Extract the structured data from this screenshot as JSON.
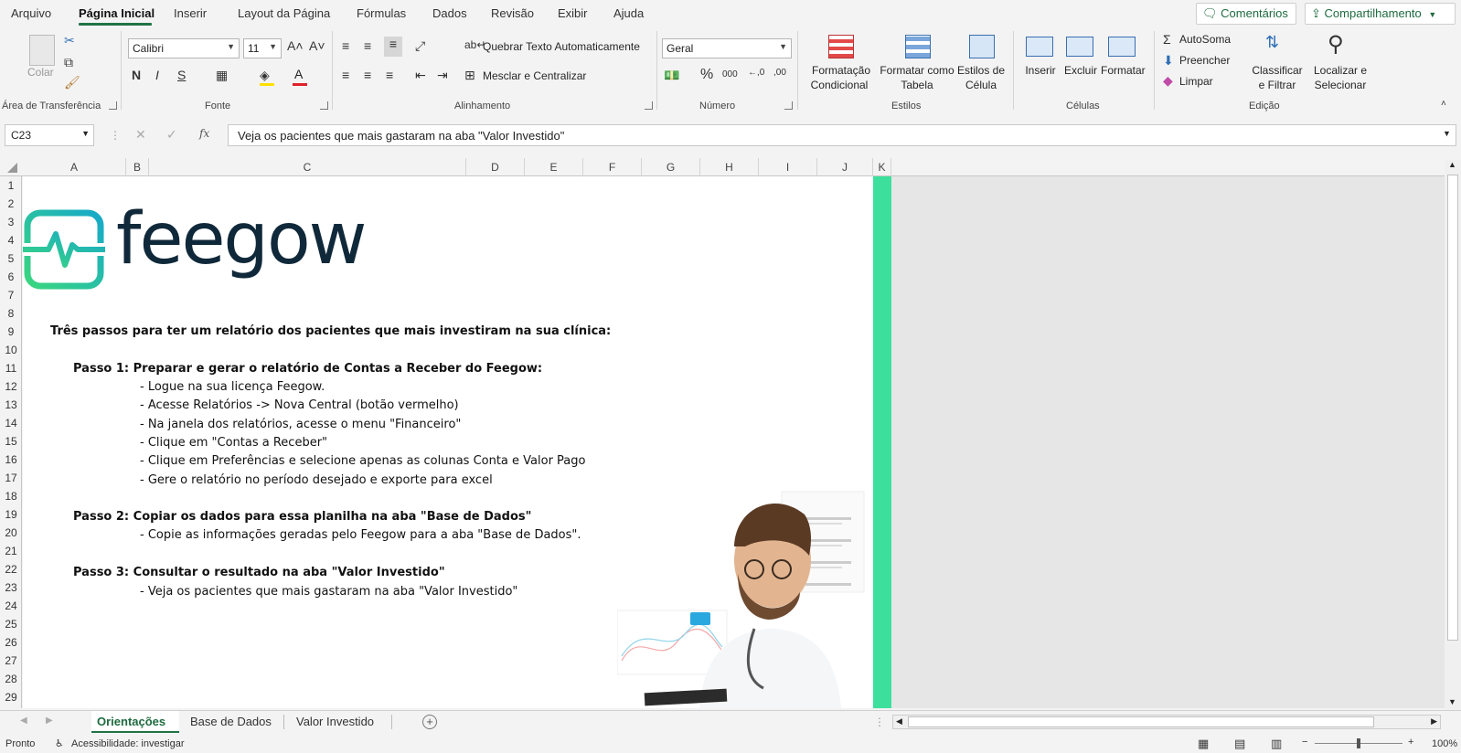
{
  "menu": {
    "tabs": [
      "Arquivo",
      "Página Inicial",
      "Inserir",
      "Layout da Página",
      "Fórmulas",
      "Dados",
      "Revisão",
      "Exibir",
      "Ajuda"
    ],
    "comments_label": "Comentários",
    "share_label": "Compartilhamento"
  },
  "ribbon": {
    "clipboard": {
      "paste": "Colar",
      "group": "Área de Transferência"
    },
    "font": {
      "name": "Calibri",
      "size": "11",
      "bold": "N",
      "italic": "I",
      "underline": "S",
      "group": "Fonte"
    },
    "alignment": {
      "wrap": "Quebrar Texto Automaticamente",
      "merge": "Mesclar e Centralizar",
      "group": "Alinhamento"
    },
    "number": {
      "format": "Geral",
      "group": "Número"
    },
    "styles": {
      "conditional": [
        "Formatação",
        "Condicional"
      ],
      "table": [
        "Formatar como",
        "Tabela"
      ],
      "cell": [
        "Estilos de",
        "Célula"
      ],
      "group": "Estilos"
    },
    "cells": {
      "insert": "Inserir",
      "delete": "Excluir",
      "format": "Formatar",
      "group": "Células"
    },
    "editing": {
      "autosum": "AutoSoma",
      "fill": "Preencher",
      "clear": "Limpar",
      "sort": [
        "Classificar",
        "e Filtrar"
      ],
      "find": [
        "Localizar e",
        "Selecionar"
      ],
      "group": "Edição"
    }
  },
  "formula_bar": {
    "name_box": "C23",
    "content": "Veja os pacientes que mais gastaram na aba \"Valor Investido\""
  },
  "columns": [
    "A",
    "B",
    "C",
    "D",
    "E",
    "F",
    "G",
    "H",
    "I",
    "J",
    "K"
  ],
  "rows": [
    "1",
    "2",
    "3",
    "4",
    "5",
    "6",
    "7",
    "8",
    "9",
    "10",
    "11",
    "12",
    "13",
    "14",
    "15",
    "16",
    "17",
    "18",
    "19",
    "20",
    "21",
    "22",
    "23",
    "24",
    "25",
    "26",
    "27",
    "28",
    "29"
  ],
  "sheet": {
    "logo_text": "feegow",
    "heading": "Três passos para ter um relatório dos pacientes que mais investiram na sua clínica:",
    "step1_title": "Passo 1: Preparar e gerar o relatório de Contas a Receber do Feegow:",
    "step1_items": [
      "-  Logue na sua licença Feegow.",
      "-  Acesse Relatórios -> Nova Central (botão vermelho)",
      "-  Na janela dos relatórios, acesse o menu \"Financeiro\"",
      "-  Clique em \"Contas a Receber\"",
      "-  Clique em Preferências e selecione apenas as colunas Conta e Valor Pago",
      "-  Gere o relatório no período desejado e exporte para excel"
    ],
    "step2_title": "Passo 2: Copiar os dados para essa planilha na aba \"Base de Dados\"",
    "step2_item": "-  Copie as informações geradas pelo Feegow para a aba \"Base de Dados\".",
    "step3_title": "Passo 3: Consultar o resultado na aba \"Valor Investido\"",
    "step3_item": "-  Veja os pacientes que mais gastaram na aba \"Valor Investido\""
  },
  "sheet_tabs": [
    "Orientações",
    "Base de Dados",
    "Valor Investido"
  ],
  "status": {
    "ready": "Pronto",
    "accessibility": "Acessibilidade: investigar",
    "zoom": "100%"
  },
  "colors": {
    "accent": "#217346",
    "brand_teal": "#17b8a6",
    "brand_dark": "#0f2a3a",
    "side_green": "#3ce09c"
  }
}
